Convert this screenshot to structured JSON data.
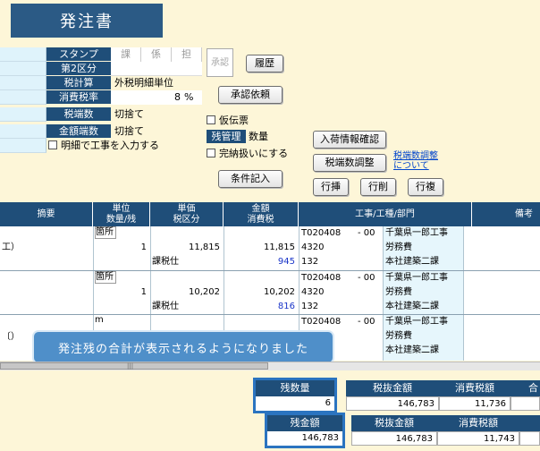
{
  "title": "発注書",
  "header": {
    "stamp_label": "スタンプ",
    "stamp_cells": [
      "課",
      "係",
      "担"
    ],
    "kubun_label": "第2区分",
    "tax_calc_label": "税計算",
    "tax_calc_value": "外税明細単位",
    "tax_rate_label": "消費税率",
    "tax_rate_value": "8",
    "tax_rate_unit": "%",
    "fraction_label": "税端数",
    "fraction_value": "切捨て",
    "amount_fraction_label": "金額端数",
    "amount_fraction_value": "切捨て",
    "detail_checkbox": "明細で工事を入力する",
    "approval_stamp": "承認",
    "history_button": "履歴",
    "approval_request_button": "承認依頼",
    "provisional_checkbox": "仮伝票",
    "zan_label": "残管理",
    "zan_value": "数量",
    "complete_checkbox": "完納扱いにする",
    "condition_button": "条件記入",
    "arrival_button": "入荷情報確認",
    "tax_fraction_button": "税端数調整",
    "tax_fraction_link_1": "税端数調整",
    "tax_fraction_link_2": "について",
    "row_insert_button": "行挿",
    "row_delete_button": "行削",
    "row_copy_button": "行複"
  },
  "table": {
    "headers": {
      "summary": "摘要",
      "unit_qty": [
        "単位",
        "数量/残"
      ],
      "price": [
        "単価",
        "税区分"
      ],
      "amount": [
        "金額",
        "消費税"
      ],
      "work": "工事/工種/部門",
      "note": "備考"
    },
    "rows": [
      {
        "summary": "工）",
        "unit": "箇所",
        "qty": "1",
        "price": "11,815",
        "amount": "11,815",
        "tax_class": "課税仕",
        "tax": "945",
        "work_code": "T020408",
        "work_suffix": "- 00",
        "work_name": "千葉県一郎工事",
        "kind_code": "4320",
        "kind_name": "労務費",
        "dept_code": "132",
        "dept_name": "本社建築二課"
      },
      {
        "summary": "",
        "unit": "箇所",
        "qty": "1",
        "price": "10,202",
        "amount": "10,202",
        "tax_class": "課税仕",
        "tax": "816",
        "work_code": "T020408",
        "work_suffix": "- 00",
        "work_name": "千葉県一郎工事",
        "kind_code": "4320",
        "kind_name": "労務費",
        "dept_code": "132",
        "dept_name": "本社建築二課"
      },
      {
        "summary": "〔）",
        "unit": "m",
        "qty": "",
        "price": "",
        "amount": "",
        "tax_class": "",
        "tax": "",
        "work_code": "T020408",
        "work_suffix": "- 00",
        "work_name": "千葉県一郎工事",
        "kind_code": "",
        "kind_name": "労務費",
        "dept_code": "",
        "dept_name": "本社建築二課"
      }
    ]
  },
  "tooltip": "発注残の合計が表示されるようになりました",
  "scroll_marker": "|||",
  "summary1": {
    "zan_qty_label": "残数量",
    "zan_qty_value": "6",
    "ex_tax_label": "税抜金額",
    "ex_tax_value": "146,783",
    "tax_label": "消費税額",
    "tax_value": "11,736",
    "total_label": "合"
  },
  "summary2": {
    "zan_amount_label": "残金額",
    "zan_amount_value": "146,783",
    "ex_tax_label": "税抜金額",
    "ex_tax_value": "146,783",
    "tax_label": "消費税額",
    "tax_value": "11,743"
  }
}
